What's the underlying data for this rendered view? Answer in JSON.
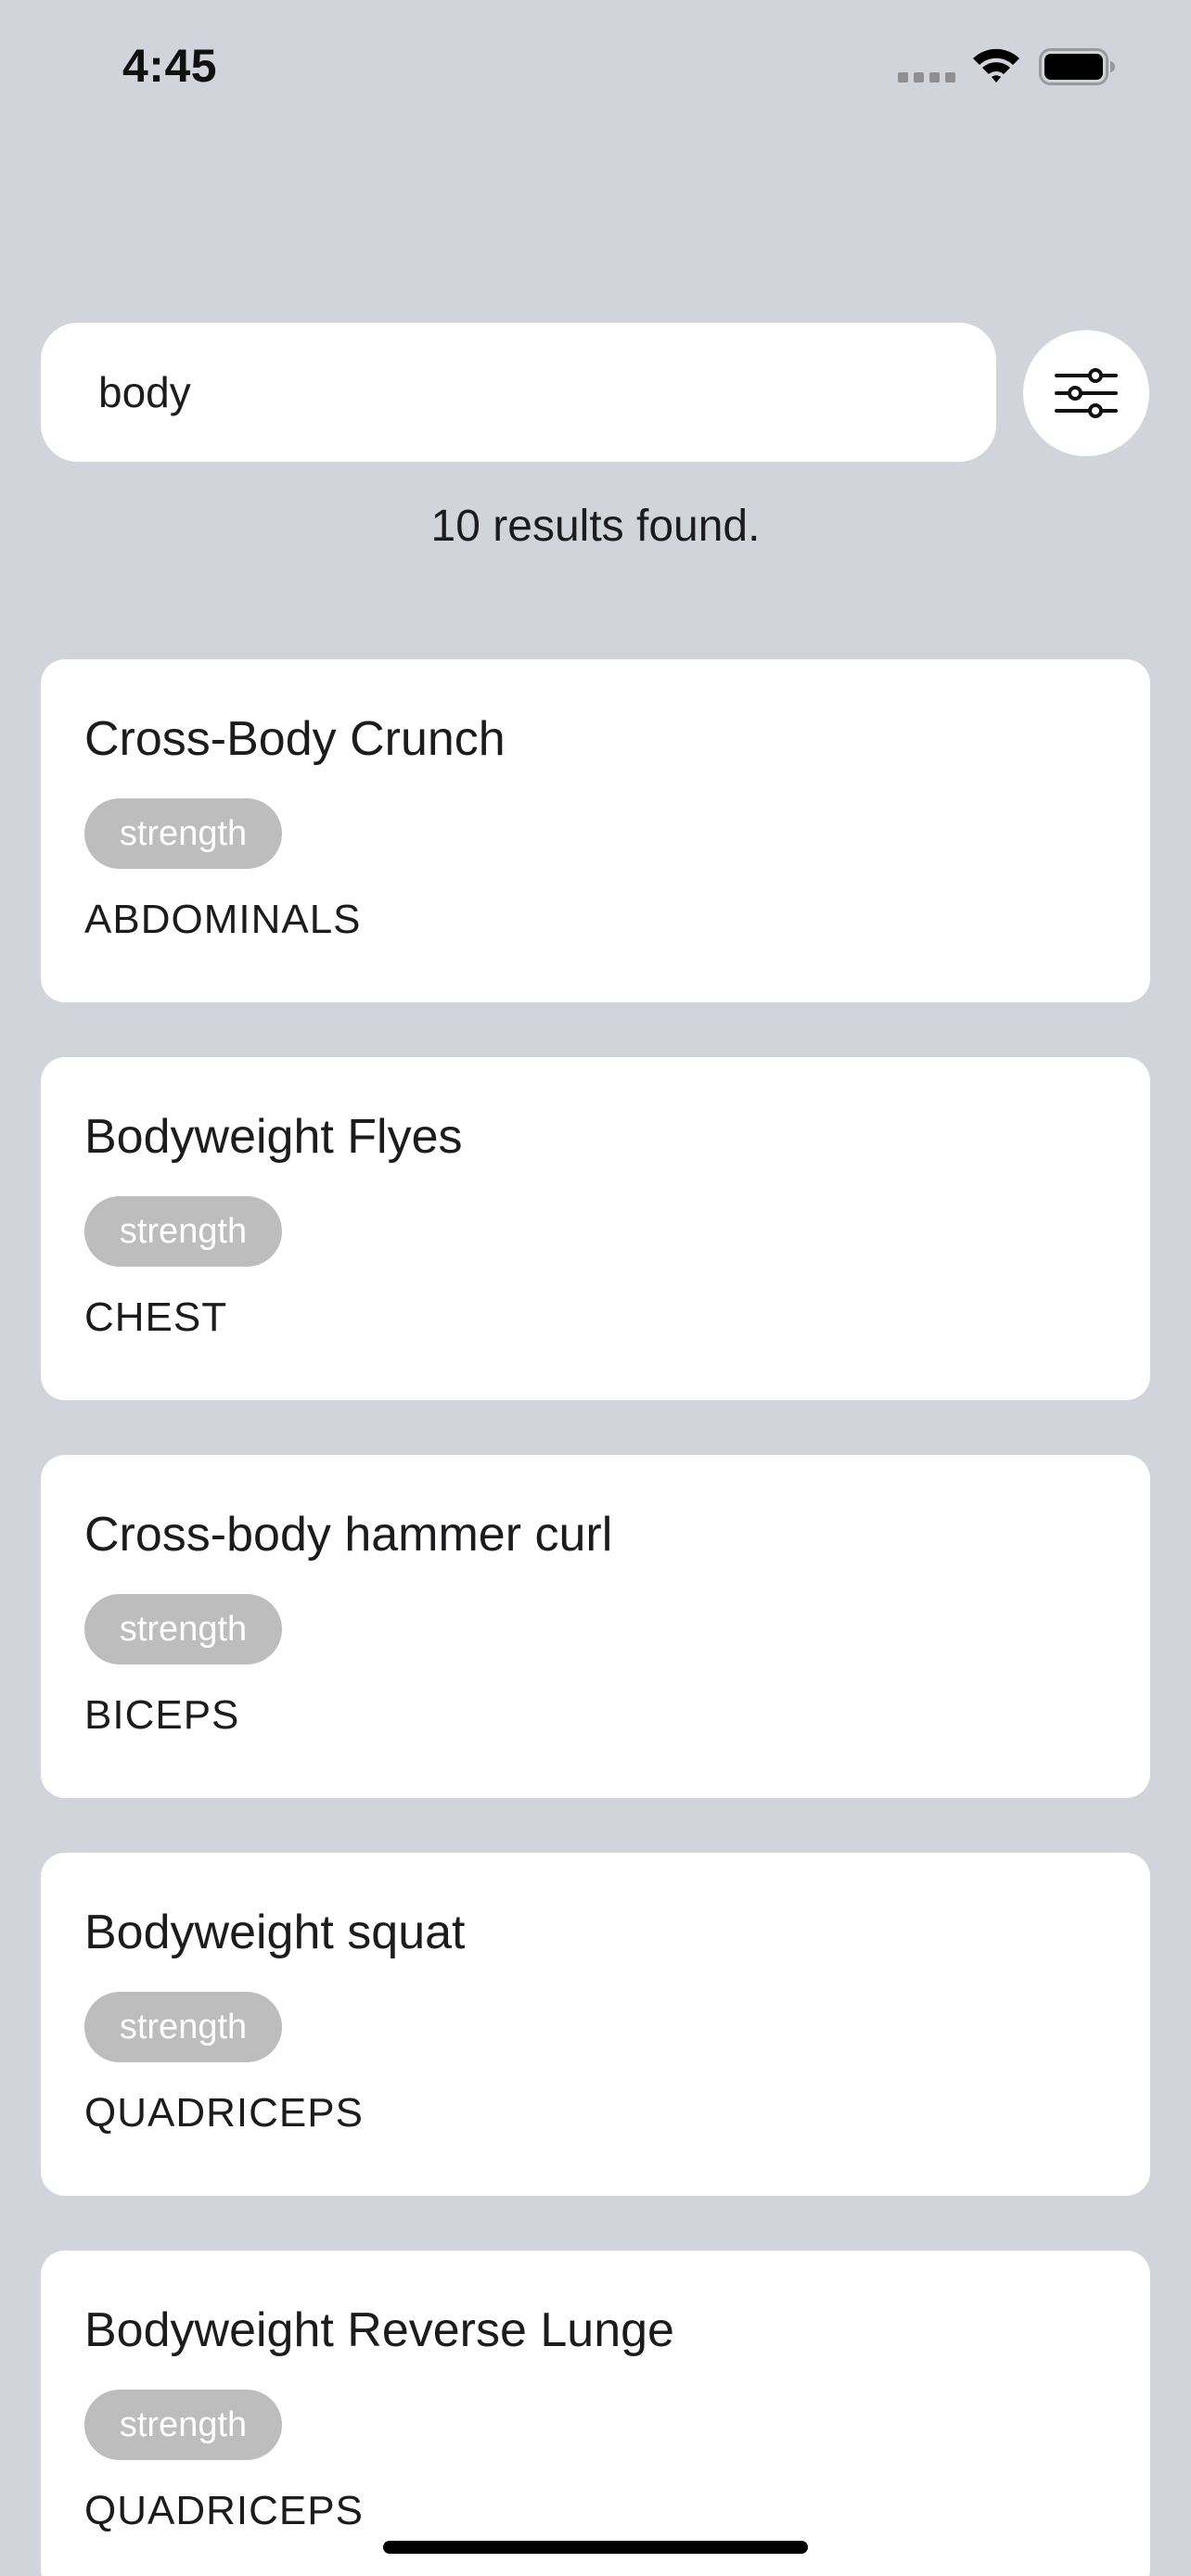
{
  "status_bar": {
    "time": "4:45",
    "icons": [
      "signal-icon",
      "wifi-icon",
      "battery-icon"
    ]
  },
  "search": {
    "value": "body",
    "filter_icon": "sliders-icon"
  },
  "results_text": "10 results found.",
  "colors": {
    "background": "#d1d4da",
    "card": "#ffffff",
    "tag_bg": "#bdbdbd",
    "tag_text": "#ffffff"
  },
  "results": [
    {
      "name": "Cross-Body Crunch",
      "type": "strength",
      "muscle": "ABDOMINALS"
    },
    {
      "name": "Bodyweight Flyes",
      "type": "strength",
      "muscle": "CHEST"
    },
    {
      "name": "Cross-body hammer curl",
      "type": "strength",
      "muscle": "BICEPS"
    },
    {
      "name": "Bodyweight squat",
      "type": "strength",
      "muscle": "QUADRICEPS"
    },
    {
      "name": "Bodyweight Reverse Lunge",
      "type": "strength",
      "muscle": "QUADRICEPS"
    }
  ]
}
